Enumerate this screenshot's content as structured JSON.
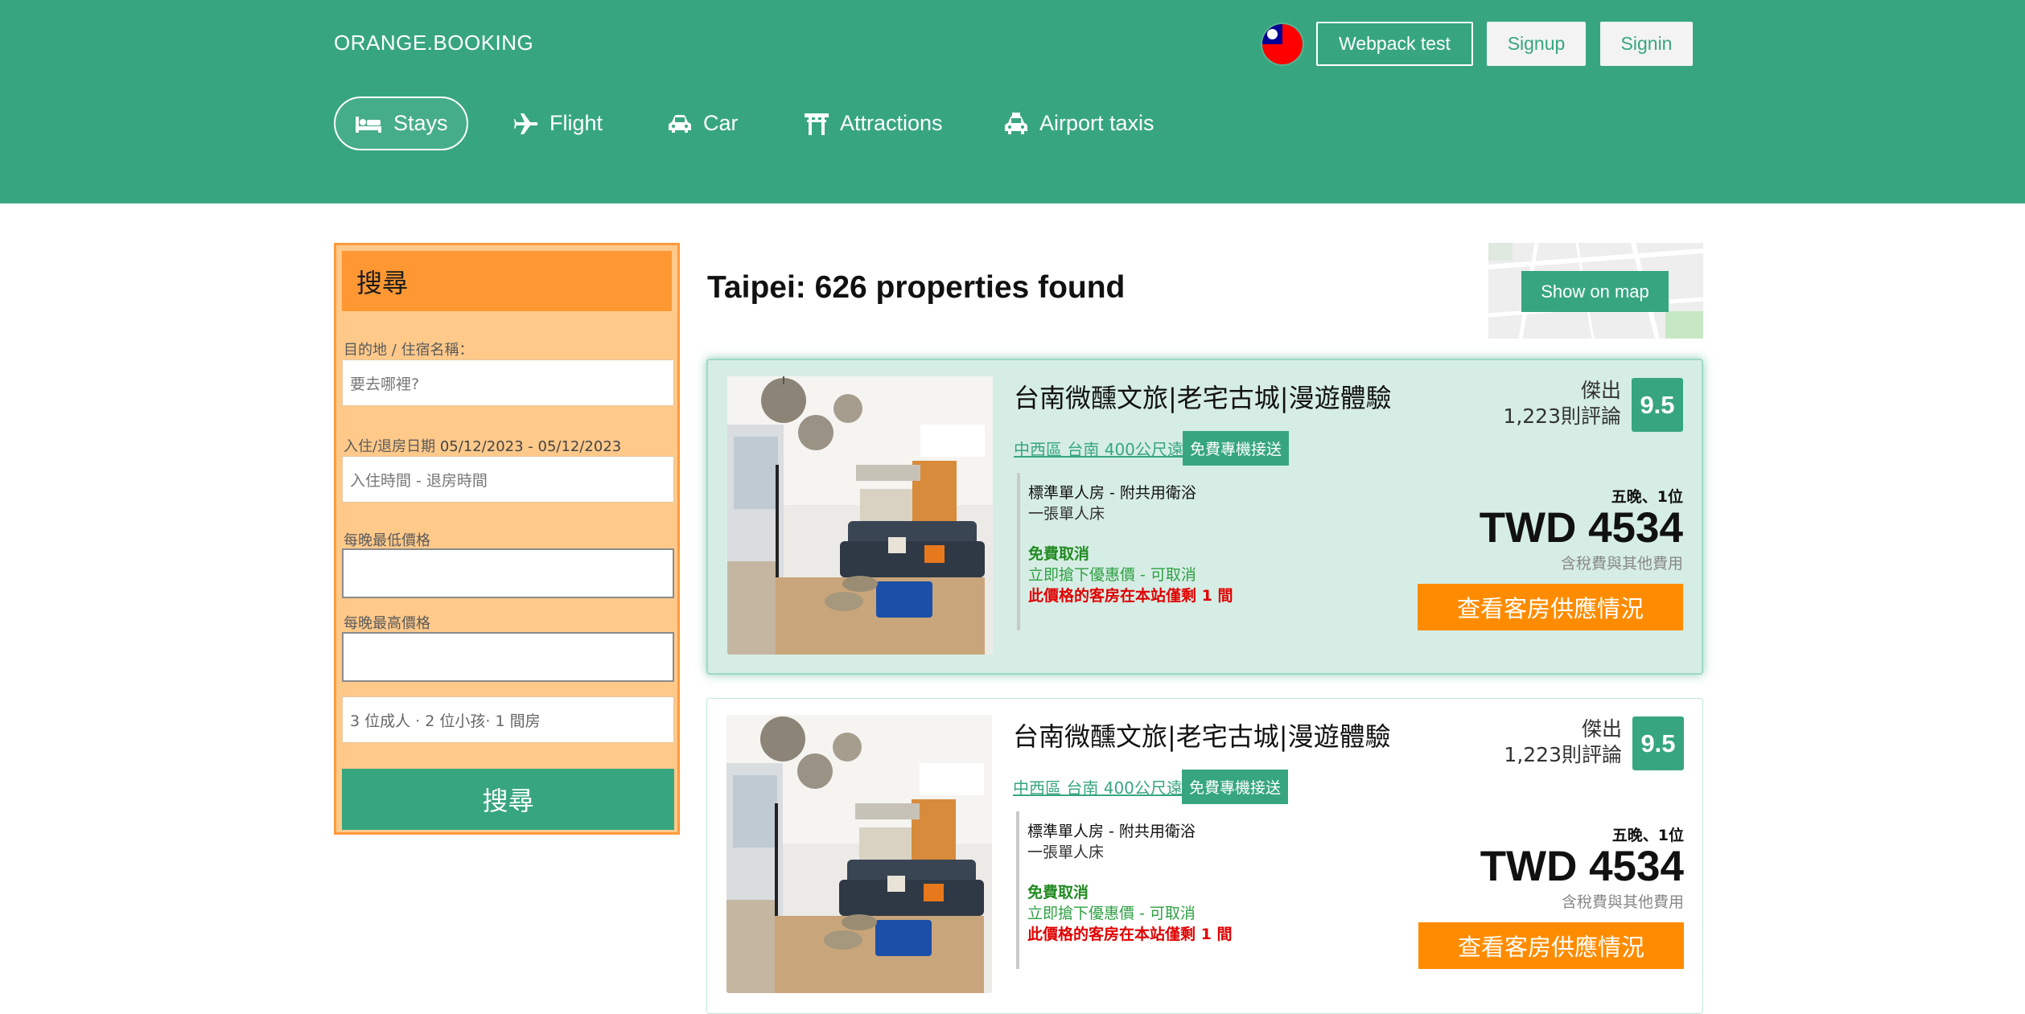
{
  "header": {
    "brand": "ORANGE.BOOKING",
    "flag_icon": "taiwan-flag-icon",
    "buttons": {
      "webpack": "Webpack test",
      "signup": "Signup",
      "signin": "Signin"
    },
    "nav": [
      {
        "label": "Stays",
        "icon": "bed-icon",
        "active": true
      },
      {
        "label": "Flight",
        "icon": "plane-icon"
      },
      {
        "label": "Car",
        "icon": "car-icon"
      },
      {
        "label": "Attractions",
        "icon": "torii-gate-icon"
      },
      {
        "label": "Airport taxis",
        "icon": "taxi-icon"
      }
    ],
    "colors": {
      "primary": "#37a680",
      "white": "#ffffff"
    }
  },
  "search": {
    "title": "搜尋",
    "destination_label": "目的地 / 住宿名稱：",
    "destination_placeholder": "要去哪裡?",
    "dates_label": "入住/退房日期",
    "dates_value": "05/12/2023 - 05/12/2023",
    "dates_placeholder": "入住時間 - 退房時間",
    "min_price_label": "每晚最低價格",
    "min_price_value": "",
    "max_price_label": "每晚最高價格",
    "max_price_value": "",
    "guests": "3 位成人 · 2 位小孩· 1 間房",
    "submit_label": "搜尋",
    "colors": {
      "panel_bg": "#ffc98a",
      "panel_border": "#ff9a3c",
      "title_bg": "#ff9833"
    }
  },
  "results": {
    "title": "Taipei: 626 properties found",
    "map_button": "Show on map",
    "cards": [
      {
        "name": "台南微醺文旅|老宅古城|漫遊體驗",
        "location": "中西區 台南 400公尺遠",
        "badge": "免費專機接送",
        "room_type": "標準單人房 - 附共用衛浴",
        "bed": "一張單人床",
        "free_cancel": "免費取消",
        "promo": "立即搶下優惠價 - 可取消",
        "rooms_left": "此價格的客房在本站僅剩 1 間",
        "review_word": "傑出",
        "review_count": "1,223則評論",
        "score": "9.5",
        "stay_info": "五晚、1位",
        "price": "TWD 4534",
        "tax_note": "含稅費與其他費用",
        "cta": "查看客房供應情況",
        "highlighted": true
      },
      {
        "name": "台南微醺文旅|老宅古城|漫遊體驗",
        "location": "中西區 台南 400公尺遠",
        "badge": "免費專機接送",
        "room_type": "標準單人房 - 附共用衛浴",
        "bed": "一張單人床",
        "free_cancel": "免費取消",
        "promo": "立即搶下優惠價 - 可取消",
        "rooms_left": "此價格的客房在本站僅剩 1 間",
        "review_word": "傑出",
        "review_count": "1,223則評論",
        "score": "9.5",
        "stay_info": "五晚、1位",
        "price": "TWD 4534",
        "tax_note": "含稅費與其他費用",
        "cta": "查看客房供應情況",
        "highlighted": false
      }
    ],
    "colors": {
      "accent_orange": "#ff8c00",
      "rooms_left_red": "#e00000",
      "free_cancel_green": "#228b22"
    }
  }
}
